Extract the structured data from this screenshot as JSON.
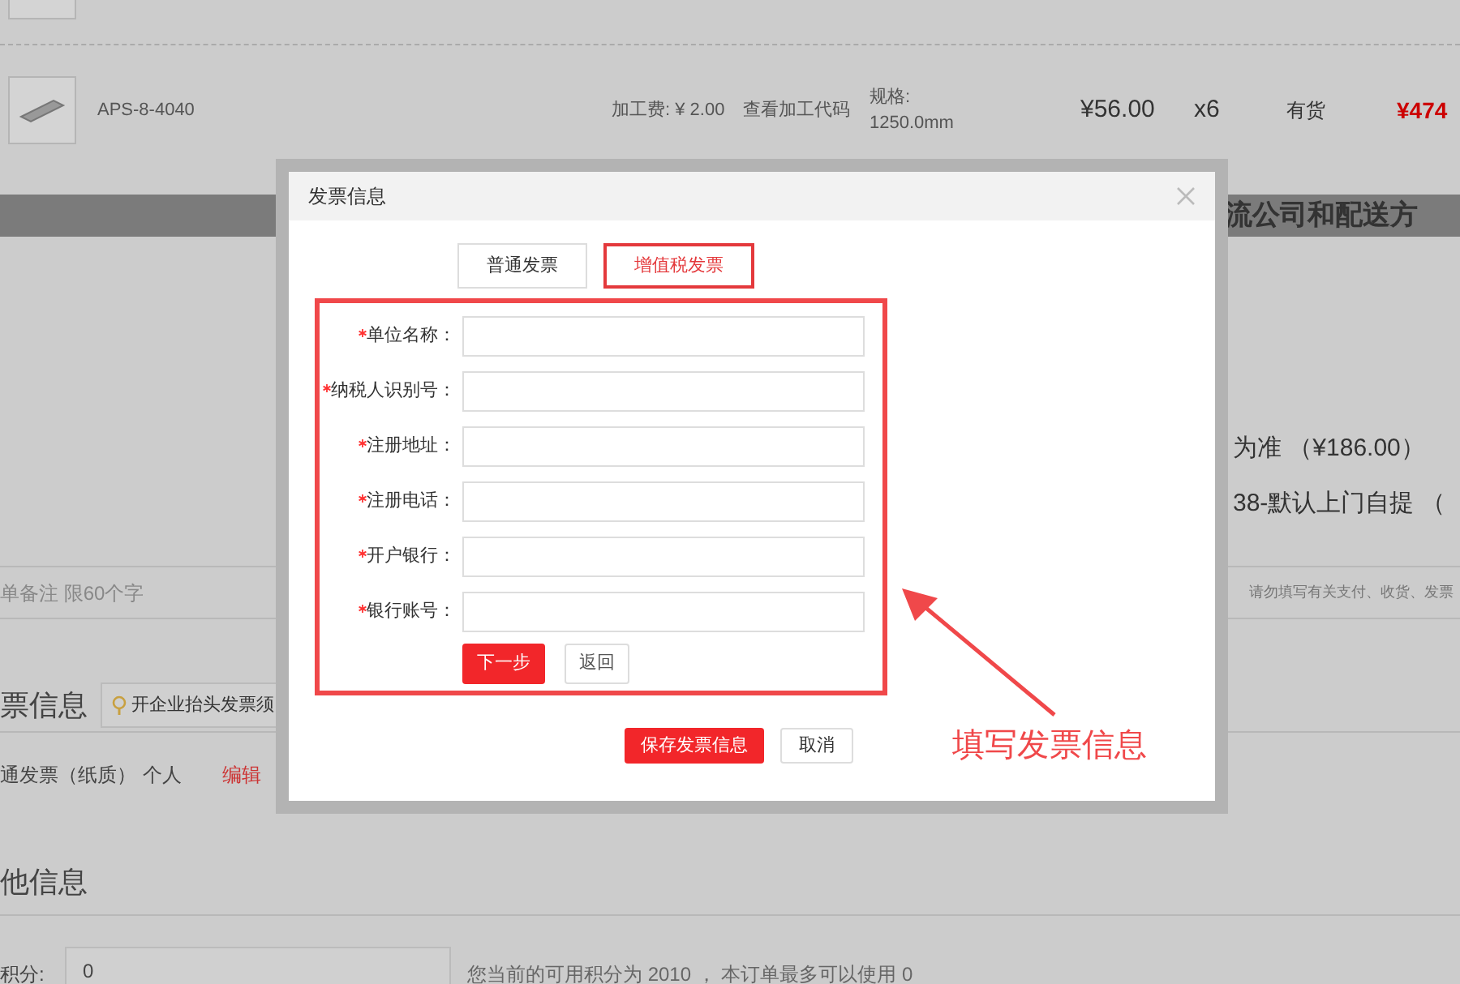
{
  "background": {
    "product": {
      "name": "APS-8-4040",
      "processing_fee": "加工费: ¥ 2.00",
      "view_code_link": "查看加工代码",
      "spec_label": "规格:",
      "spec_value": "1250.0mm",
      "price": "¥56.00",
      "quantity": "x6",
      "stock": "有货",
      "subtotal": "¥474"
    },
    "section_banner": "流公司和配送方",
    "shipping_lines": [
      "为准 （¥186.00）",
      "38-默认上门自提 （"
    ],
    "order_note": {
      "placeholder": "单备注 限60个字",
      "hint": "请勿填写有关支付、收货、发票"
    },
    "invoice_section": {
      "title": "票信息",
      "tip": "开企业抬头发票须",
      "invoice_type": "通发票（纸质）",
      "invoice_title": "个人",
      "edit_link": "编辑"
    },
    "other_section": {
      "title": "他信息",
      "points_label": "积分:",
      "points_value": "0",
      "points_hint": "您当前的可用积分为 2010 ， 本订单最多可以使用 0"
    }
  },
  "dialog": {
    "title": "发票信息",
    "tabs": [
      {
        "label": "普通发票",
        "selected": false
      },
      {
        "label": "增值税发票",
        "selected": true
      }
    ],
    "fields": [
      {
        "label": "单位名称：",
        "required": true
      },
      {
        "label": "纳税人识别号：",
        "required": true
      },
      {
        "label": "注册地址：",
        "required": true
      },
      {
        "label": "注册电话：",
        "required": true
      },
      {
        "label": "开户银行：",
        "required": true
      },
      {
        "label": "银行账号：",
        "required": true
      }
    ],
    "next_button": "下一步",
    "back_button": "返回",
    "save_button": "保存发票信息",
    "cancel_button": "取消"
  },
  "annotation": {
    "text": "填写发票信息"
  }
}
